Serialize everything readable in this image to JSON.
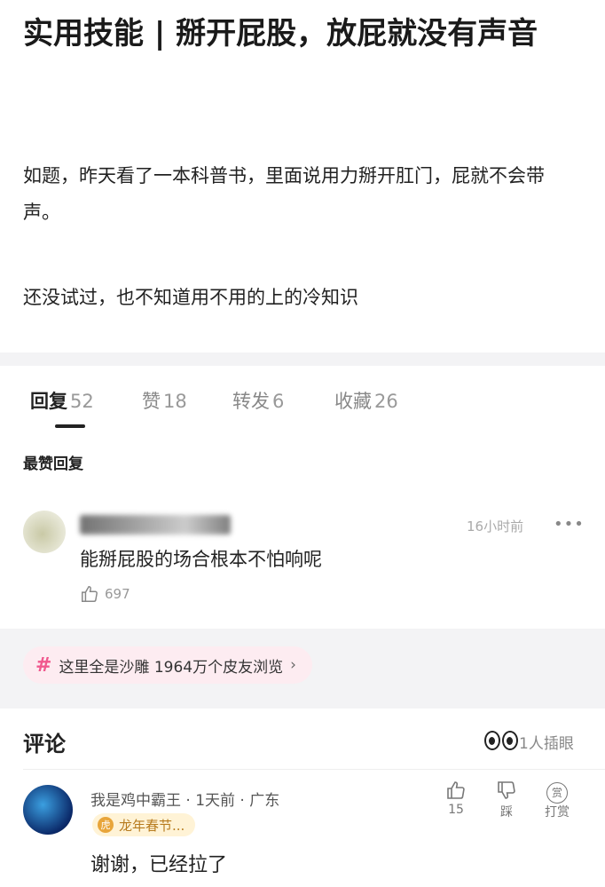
{
  "post": {
    "title": "实用技能 | 掰开屁股，放屁就没有声音",
    "paragraph1": "如题，昨天看了一本科普书，里面说用力掰开肛门，屁就不会带声。",
    "paragraph2": "还没试过，也不知道用不用的上的冷知识"
  },
  "tabs": [
    {
      "label": "回复",
      "count": "52"
    },
    {
      "label": "赞",
      "count": "18"
    },
    {
      "label": "转发",
      "count": "6"
    },
    {
      "label": "收藏",
      "count": "26"
    }
  ],
  "top_reply": {
    "section_title": "最赞回复",
    "time": "16小时前",
    "more": "•••",
    "text": "能掰屁股的场合根本不怕响呢",
    "likes": "697"
  },
  "topic": {
    "hash": "#",
    "label": "这里全是沙雕  1964万个皮友浏览",
    "arrow": "›"
  },
  "comments": {
    "title": "评论",
    "peek_label": "1人插眼",
    "item": {
      "username": "我是鸡中霸王 · 1天前 · 广东",
      "badge": "龙年春节...",
      "text": "谢谢，已经拉了",
      "likes": "15",
      "dislike_label": "踩",
      "tip_label": "打赏",
      "tip_icon_char": "赏"
    }
  }
}
